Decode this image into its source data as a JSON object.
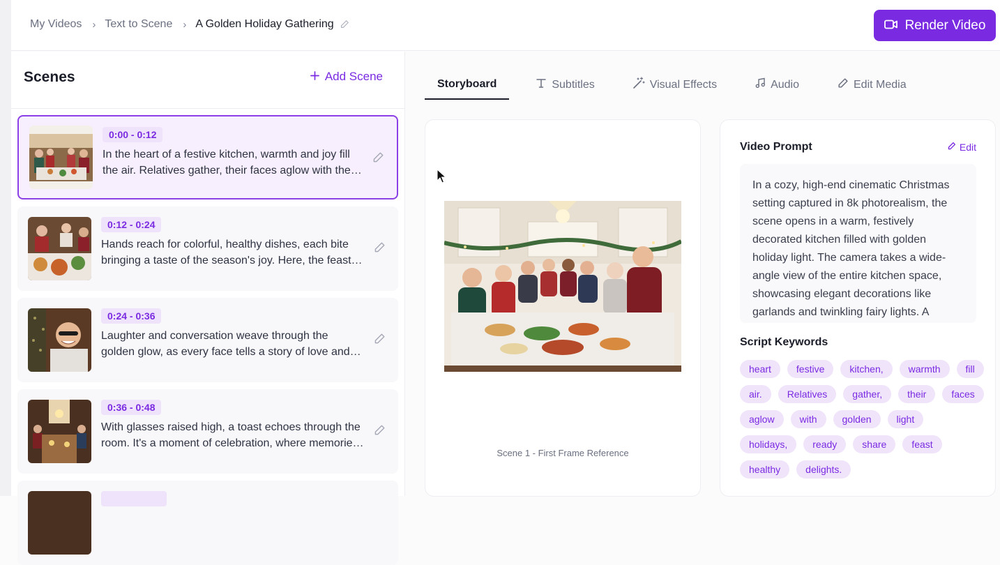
{
  "header": {
    "breadcrumbs": [
      "My Videos",
      "Text to Scene",
      "A Golden Holiday Gathering"
    ],
    "render_label": "Render Video"
  },
  "scenes_panel": {
    "title": "Scenes",
    "add_label": "Add Scene",
    "items": [
      {
        "time": "0:00 - 0:12",
        "text": "In the heart of a festive kitchen, warmth and joy fill the air. Relatives gather, their faces aglow with the golden light of the holidays."
      },
      {
        "time": "0:12 - 0:24",
        "text": "Hands reach for colorful, healthy dishes, each bite bringing a taste of the season's joy. Here, the feast is shared."
      },
      {
        "time": "0:24 - 0:36",
        "text": "Laughter and conversation weave through the golden glow, as every face tells a story of love and togetherness."
      },
      {
        "time": "0:36 - 0:48",
        "text": "With glasses raised high, a toast echoes through the room. It's a moment of celebration, where memories are made."
      }
    ]
  },
  "tabs": [
    "Storyboard",
    "Subtitles",
    "Visual Effects",
    "Audio",
    "Edit Media"
  ],
  "storyboard": {
    "caption": "Scene 1 - First Frame Reference"
  },
  "prompt": {
    "title": "Video Prompt",
    "edit_label": "Edit",
    "text": "In a cozy, high-end cinematic Christmas setting captured in 8k photorealism, the scene opens in a warm, festively decorated kitchen filled with golden holiday light. The camera takes a wide-angle view of the entire kitchen space, showcasing elegant decorations like garlands and twinkling fairy lights. A",
    "keywords_title": "Script Keywords",
    "keywords": [
      "heart",
      "festive",
      "kitchen,",
      "warmth",
      "fill",
      "air.",
      "Relatives",
      "gather,",
      "their",
      "faces",
      "aglow",
      "with",
      "golden",
      "light",
      "holidays,",
      "ready",
      "share",
      "feast",
      "healthy",
      "delights."
    ]
  },
  "colors": {
    "accent": "#7a2be2",
    "accent_light": "#f0e4fb"
  },
  "icons": {
    "render": "video-camera-icon",
    "add": "plus-icon",
    "edit": "pencil-icon",
    "subtitles": "text-t-icon",
    "effects": "magic-wand-icon",
    "audio": "music-note-icon"
  }
}
